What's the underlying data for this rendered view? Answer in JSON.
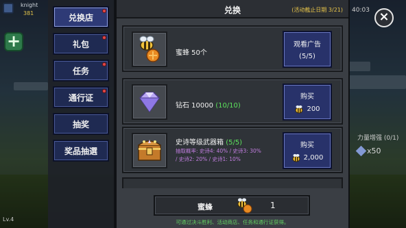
{
  "hud": {
    "player_name": "knight",
    "gold": "381",
    "level": "Lv.4",
    "timer": "40:03",
    "buff": "力量增强 (0/1)",
    "gem_count": "x50"
  },
  "menu": {
    "items": [
      {
        "label": "兑换店",
        "active": true,
        "notify": true
      },
      {
        "label": "礼包",
        "active": false,
        "notify": true
      },
      {
        "label": "任务",
        "active": false,
        "notify": true
      },
      {
        "label": "通行证",
        "active": false,
        "notify": true
      },
      {
        "label": "抽奖",
        "active": false,
        "notify": false
      },
      {
        "label": "奖品抽選",
        "active": false,
        "notify": false
      }
    ]
  },
  "panel": {
    "title": "兑换",
    "deadline": "(活动截止日期 3/21)",
    "rows": [
      {
        "title_main": "蜜蜂 50个",
        "title_highlight": "",
        "sub_lines": [],
        "icon": "bee-honey-icon",
        "button_label": "观看广告",
        "button_value": "(5/5)",
        "price_icon": ""
      },
      {
        "title_main": "钻石 10000",
        "title_highlight": "(10/10)",
        "sub_lines": [],
        "icon": "diamond-icon",
        "button_label": "购买",
        "button_value": "200",
        "price_icon": "bee-icon"
      },
      {
        "title_main": "史诗等级武器箱",
        "title_highlight": "(5/5)",
        "sub_lines": [
          "抽取概率: 史诗4: 40% / 史诗3: 30%",
          "/ 史诗2: 20% / 史诗1: 10%"
        ],
        "icon": "treasure-chest-icon",
        "button_label": "购买",
        "button_value": "2,000",
        "price_icon": "bee-icon"
      }
    ]
  },
  "footer": {
    "currency_label": "蜜蜂",
    "currency_count": "1",
    "hint": "可通过决斗胜利、活动商店、任务和通行证获得。"
  },
  "close": {
    "symbol": "×"
  },
  "colors": {
    "highlight_green": "#5de45d",
    "deadline_yellow": "#e9c64a",
    "sub_purple": "#c27ee0",
    "button_blue": "#28326a"
  }
}
